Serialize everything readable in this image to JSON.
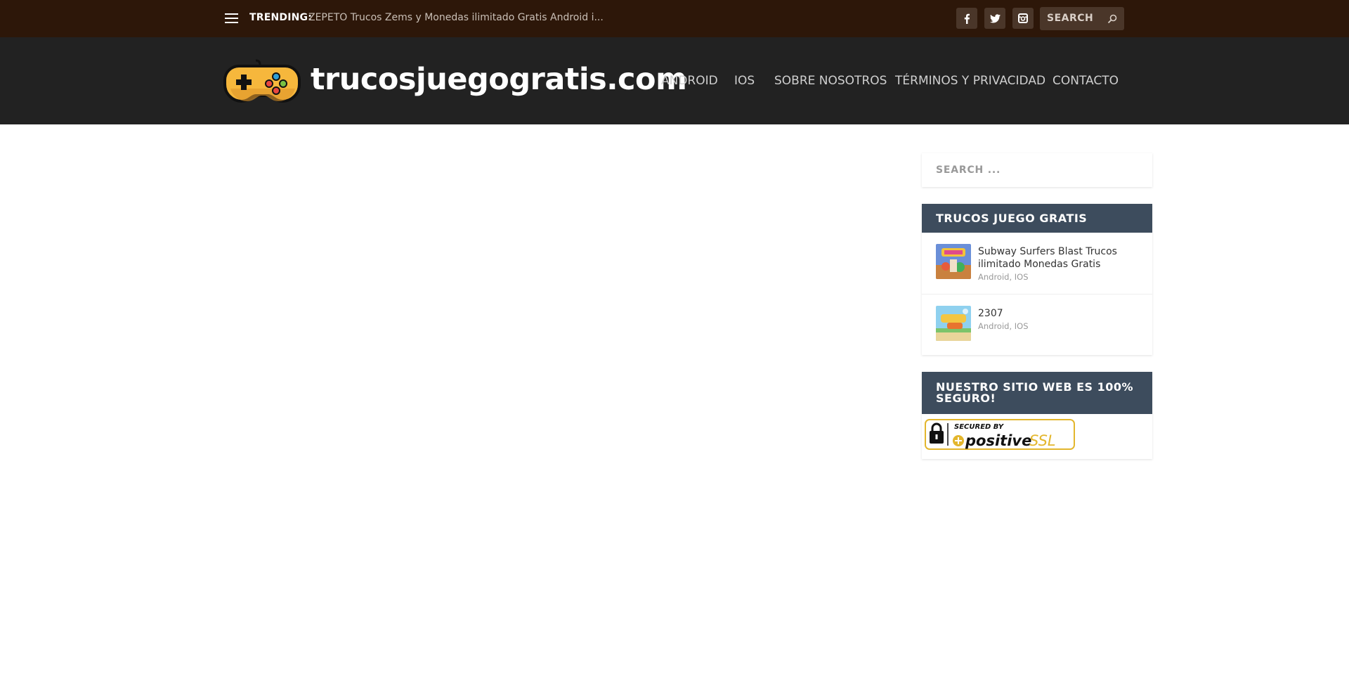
{
  "topbar": {
    "trending_label": "TRENDING:",
    "trending_text": "ZEPETO Trucos Zems y Monedas ilimitado Gratis Android i...",
    "search_placeholder": "SEARCH",
    "social": [
      "facebook-icon",
      "twitter-icon",
      "instagram-icon"
    ]
  },
  "header": {
    "logo_text": "trucosjuegogratis.com",
    "nav": [
      {
        "label": "ANDROID"
      },
      {
        "label": "IOS"
      },
      {
        "label": "SOBRE NOSOTROS"
      },
      {
        "label": "TÉRMINOS Y PRIVACIDAD"
      },
      {
        "label": "CONTACTO"
      }
    ]
  },
  "sidebar": {
    "search_placeholder": "SEARCH ...",
    "widget1": {
      "title": "TRUCOS JUEGO GRATIS",
      "posts": [
        {
          "title": "Subway Surfers Blast Trucos ilimitado Monedas Gratis",
          "meta": "Android, IOS"
        },
        {
          "title": "2307",
          "meta": "Android, IOS"
        }
      ]
    },
    "widget2": {
      "title": "NUESTRO SITIO WEB ES 100% SEGURO!",
      "ssl_secured": "SECURED BY",
      "ssl_brand": "positive",
      "ssl_suffix": "SSL"
    }
  },
  "colors": {
    "topbar_bg": "#2d1709",
    "header_bg": "#222222",
    "widget_title_bg": "#3d4c5d"
  }
}
